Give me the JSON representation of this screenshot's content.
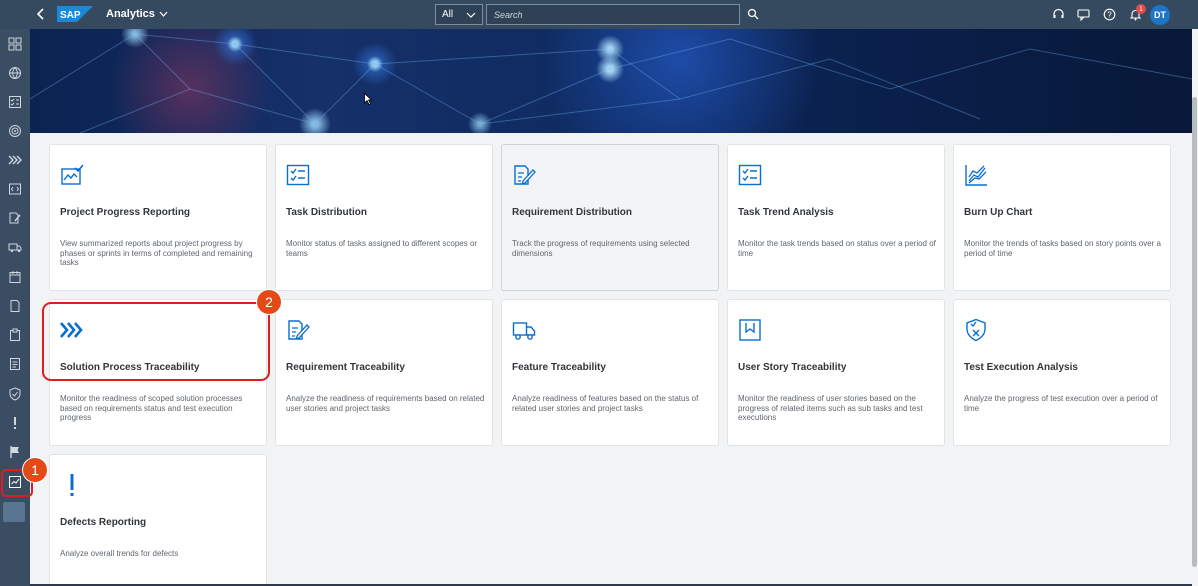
{
  "shell": {
    "app_title": "Analytics",
    "scope_value": "All",
    "search_placeholder": "Search",
    "notification_count": "1",
    "avatar_initials": "DT"
  },
  "colors": {
    "shell_bg": "#354a5f",
    "icon_blue": "#0a6ed1",
    "highlight_red": "#e11c1c",
    "marker_orange": "#e24b18"
  },
  "tiles": [
    {
      "title": "Project Progress Reporting",
      "desc": "View summarized reports about project progress by phases or sprints in terms of completed and remaining tasks",
      "icon": "chart-check-icon"
    },
    {
      "title": "Task Distribution",
      "desc": "Monitor status of tasks assigned to different scopes or teams",
      "icon": "checklist-icon"
    },
    {
      "title": "Requirement Distribution",
      "desc": "Track the progress of requirements using selected dimensions",
      "icon": "document-edit-icon"
    },
    {
      "title": "Task Trend Analysis",
      "desc": "Monitor the task trends based on status over a period of time",
      "icon": "checklist-icon"
    },
    {
      "title": "Burn Up Chart",
      "desc": "Monitor the trends of tasks based on story points over a period of time",
      "icon": "line-chart-icon"
    },
    {
      "title": "Solution Process Traceability",
      "desc": "Monitor the readiness of scoped solution processes based on requirements status and test execution progress",
      "icon": "process-chevrons-icon"
    },
    {
      "title": "Requirement Traceability",
      "desc": "Analyze the readiness of requirements based on related user stories and project tasks",
      "icon": "document-edit-icon"
    },
    {
      "title": "Feature Traceability",
      "desc": "Analyze readiness of features based on the status of related user stories and project tasks",
      "icon": "truck-icon"
    },
    {
      "title": "User Story Traceability",
      "desc": "Monitor the readiness of user stories based on the progress of related items such as sub tasks and test executions",
      "icon": "bookmark-icon"
    },
    {
      "title": "Test Execution Analysis",
      "desc": "Analyze the progress of test execution over a period of time",
      "icon": "shield-check-icon"
    },
    {
      "title": "Defects Reporting",
      "desc": "Analyze overall trends for defects",
      "icon": "exclamation-icon"
    }
  ],
  "markers": [
    "1",
    "2"
  ]
}
